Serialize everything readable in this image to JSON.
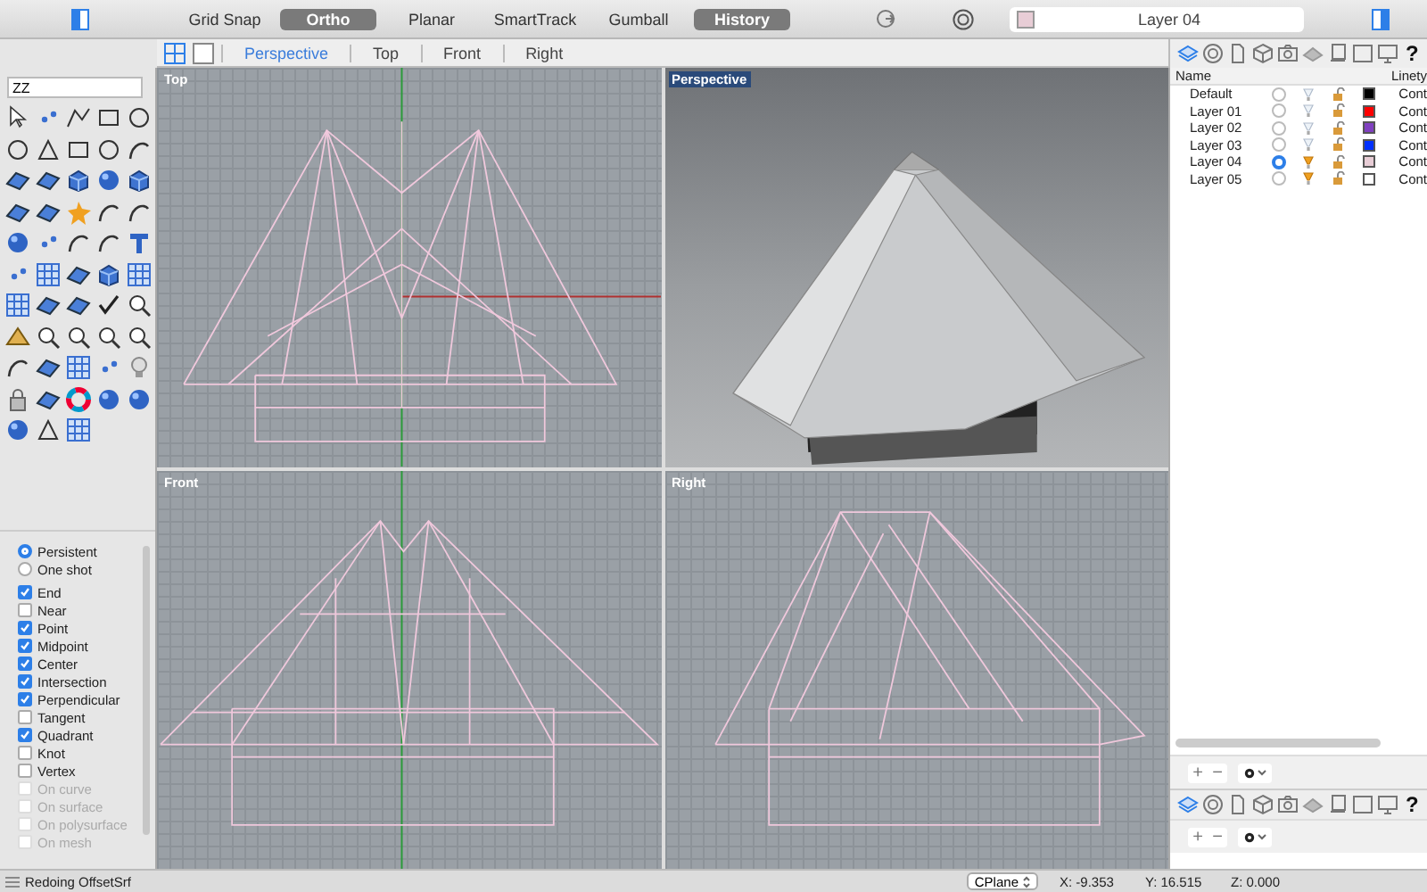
{
  "toolbar": {
    "toggles": [
      {
        "label": "Grid Snap",
        "on": false
      },
      {
        "label": "Ortho",
        "on": true
      },
      {
        "label": "Planar",
        "on": false
      },
      {
        "label": "SmartTrack",
        "on": false
      },
      {
        "label": "Gumball",
        "on": false
      },
      {
        "label": "History",
        "on": true
      }
    ],
    "layer_field": {
      "value": "Layer 04",
      "color": "#e8cdd6"
    }
  },
  "viewport_tabs": [
    {
      "label": "Perspective",
      "selected": true
    },
    {
      "label": "Top",
      "selected": false
    },
    {
      "label": "Front",
      "selected": false
    },
    {
      "label": "Right",
      "selected": false
    }
  ],
  "panel_tabs_top": {
    "help": "?"
  },
  "command_field": {
    "value": "ZZ"
  },
  "osnap": {
    "modes": [
      {
        "label": "Persistent",
        "selected": true
      },
      {
        "label": "One shot",
        "selected": false
      }
    ],
    "snaps": [
      {
        "label": "End",
        "checked": true,
        "disabled": false
      },
      {
        "label": "Near",
        "checked": false,
        "disabled": false
      },
      {
        "label": "Point",
        "checked": true,
        "disabled": false
      },
      {
        "label": "Midpoint",
        "checked": true,
        "disabled": false
      },
      {
        "label": "Center",
        "checked": true,
        "disabled": false
      },
      {
        "label": "Intersection",
        "checked": true,
        "disabled": false
      },
      {
        "label": "Perpendicular",
        "checked": true,
        "disabled": false
      },
      {
        "label": "Tangent",
        "checked": false,
        "disabled": false
      },
      {
        "label": "Quadrant",
        "checked": true,
        "disabled": false
      },
      {
        "label": "Knot",
        "checked": false,
        "disabled": false
      },
      {
        "label": "Vertex",
        "checked": false,
        "disabled": false
      },
      {
        "label": "On curve",
        "checked": false,
        "disabled": true
      },
      {
        "label": "On surface",
        "checked": false,
        "disabled": true
      },
      {
        "label": "On polysurface",
        "checked": false,
        "disabled": true
      },
      {
        "label": "On mesh",
        "checked": false,
        "disabled": true
      }
    ]
  },
  "viewports": [
    {
      "title": "Top",
      "kind": "top",
      "active": false
    },
    {
      "title": "Perspective",
      "kind": "perspective",
      "active": true
    },
    {
      "title": "Front",
      "kind": "front",
      "active": false
    },
    {
      "title": "Right",
      "kind": "right",
      "active": false
    }
  ],
  "layers": {
    "columns": [
      "Name",
      "Linety"
    ],
    "rows": [
      {
        "name": "Default",
        "current": false,
        "lit": false,
        "color": "#000000",
        "linetype": "Cont"
      },
      {
        "name": "Layer 01",
        "current": false,
        "lit": false,
        "color": "#ff0000",
        "linetype": "Cont"
      },
      {
        "name": "Layer 02",
        "current": false,
        "lit": false,
        "color": "#8040c0",
        "linetype": "Cont"
      },
      {
        "name": "Layer 03",
        "current": false,
        "lit": false,
        "color": "#0030ff",
        "linetype": "Cont"
      },
      {
        "name": "Layer 04",
        "current": true,
        "lit": true,
        "color": "#e8cdd6",
        "linetype": "Cont"
      },
      {
        "name": "Layer 05",
        "current": false,
        "lit": true,
        "color": "#ffffff",
        "linetype": "Cont"
      }
    ],
    "buttons": {
      "add": "+",
      "remove": "−"
    }
  },
  "panel_tabs_bottom": {
    "help": "?"
  },
  "bottom_buttons": {
    "add": "+",
    "remove": "−"
  },
  "status_bar": {
    "message": "Redoing OffsetSrf",
    "cplane": "CPlane",
    "x": "X: -9.353",
    "y": "Y: 16.515",
    "z": "Z: 0.000"
  }
}
